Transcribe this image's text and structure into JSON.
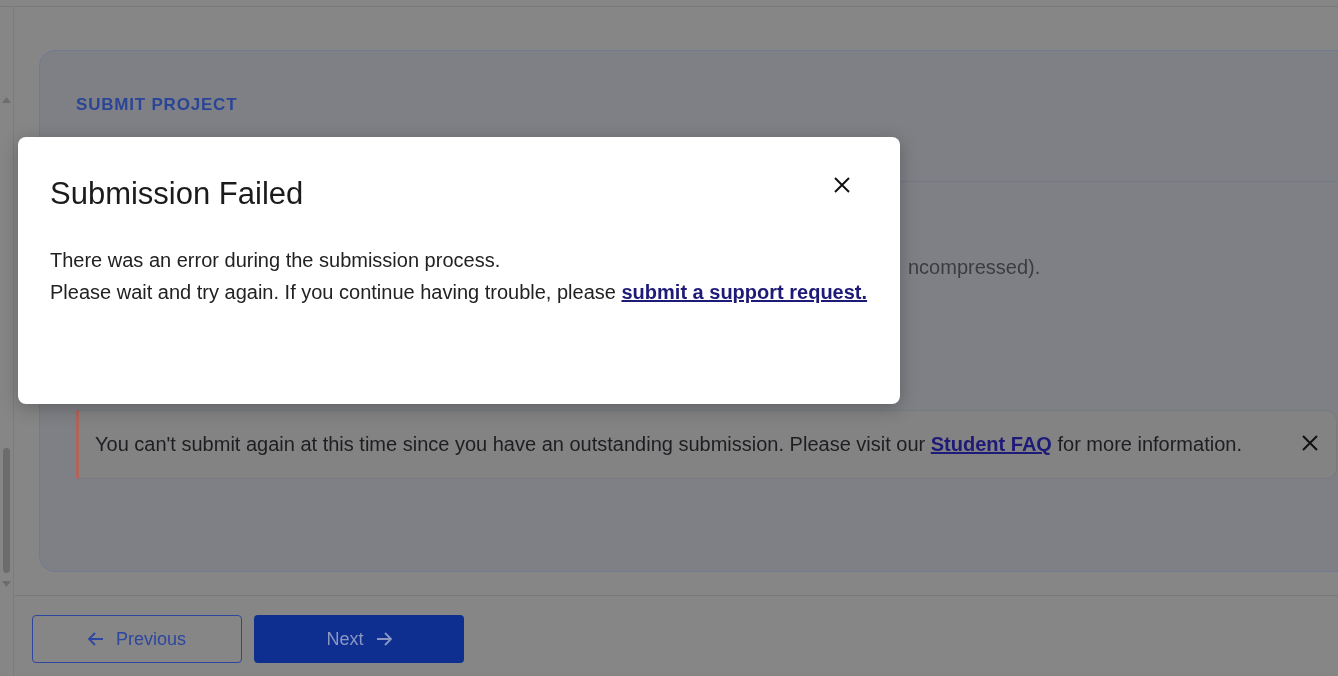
{
  "card": {
    "title": "SUBMIT PROJECT",
    "body_text": "ncompressed).",
    "alert": {
      "text_before": "You can't submit again at this time since you have an outstanding submission. Please visit our",
      "link": "Student FAQ",
      "text_after": "for more information."
    }
  },
  "buttons": [
    {
      "kind": "previous",
      "label": "Previous"
    },
    {
      "kind": "next",
      "label": "Next"
    }
  ],
  "modal": {
    "title": "Submission Failed",
    "line_1": "There was an error during the submission process.",
    "line_2": "Please wait and try again. If you continue having trouble, please",
    "link": "submit a support request."
  }
}
